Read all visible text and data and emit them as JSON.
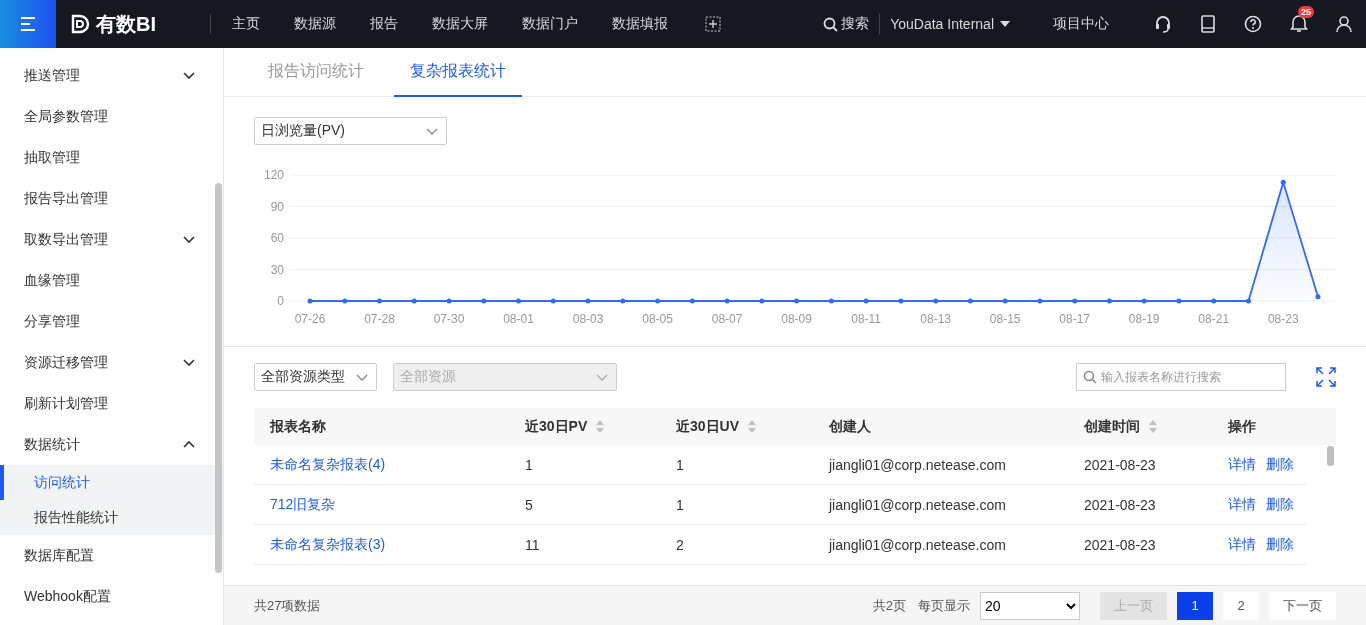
{
  "header": {
    "logo_text": "有数BI",
    "nav": [
      "主页",
      "数据源",
      "报告",
      "数据大屏",
      "数据门户",
      "数据填报"
    ],
    "search": "搜索",
    "workspace": "YouData Internal",
    "project_center": "项目中心",
    "notification_count": "25"
  },
  "sidebar": {
    "items": [
      {
        "label": "推送管理",
        "expanded": false,
        "selected": false,
        "kind": "group"
      },
      {
        "label": "全局参数管理",
        "selected": false,
        "kind": "item"
      },
      {
        "label": "抽取管理",
        "selected": false,
        "kind": "item"
      },
      {
        "label": "报告导出管理",
        "selected": false,
        "kind": "item"
      },
      {
        "label": "取数导出管理",
        "expanded": false,
        "selected": false,
        "kind": "group"
      },
      {
        "label": "血缘管理",
        "selected": false,
        "kind": "item"
      },
      {
        "label": "分享管理",
        "selected": false,
        "kind": "item"
      },
      {
        "label": "资源迁移管理",
        "expanded": false,
        "selected": false,
        "kind": "group"
      },
      {
        "label": "刷新计划管理",
        "selected": false,
        "kind": "item"
      },
      {
        "label": "数据统计",
        "expanded": true,
        "selected": false,
        "kind": "group",
        "children": [
          {
            "label": "访问统计",
            "selected": true
          },
          {
            "label": "报告性能统计",
            "selected": false
          }
        ]
      },
      {
        "label": "数据库配置",
        "selected": false,
        "kind": "item"
      },
      {
        "label": "Webhook配置",
        "selected": false,
        "kind": "item"
      }
    ]
  },
  "tabs": [
    {
      "label": "报告访问统计",
      "selected": false
    },
    {
      "label": "复杂报表统计",
      "selected": true
    }
  ],
  "metric_select": "日浏览量(PV)",
  "chart_data": {
    "type": "area",
    "grid": true,
    "categories": [
      "07-26",
      null,
      "07-28",
      null,
      "07-30",
      null,
      "08-01",
      null,
      "08-03",
      null,
      "08-05",
      null,
      "08-07",
      null,
      "08-09",
      null,
      "08-11",
      null,
      "08-13",
      null,
      "08-15",
      null,
      "08-17",
      null,
      "08-19",
      null,
      "08-21",
      null,
      "08-23",
      null
    ],
    "series": [
      {
        "color": "#2f6bf5",
        "values": [
          0,
          0,
          0,
          0,
          0,
          0,
          0,
          0,
          0,
          0,
          0,
          0,
          0,
          0,
          0,
          0,
          0,
          0,
          0,
          0,
          0,
          0,
          0,
          0,
          0,
          0,
          0,
          0,
          113,
          4
        ]
      }
    ],
    "ylim": [
      0,
      120
    ],
    "yticks": [
      0,
      30,
      60,
      90,
      120
    ]
  },
  "filters": {
    "type_select": {
      "value": "全部资源类型",
      "disabled": false
    },
    "resource_select": {
      "value": "全部资源",
      "disabled": true
    },
    "search": {
      "placeholder": "输入报表名称进行搜索"
    }
  },
  "table": {
    "columns": [
      {
        "label": "报表名称",
        "sortable": false
      },
      {
        "label": "近30日PV",
        "sortable": true
      },
      {
        "label": "近30日UV",
        "sortable": true
      },
      {
        "label": "创建人",
        "sortable": false
      },
      {
        "label": "创建时间",
        "sortable": true
      },
      {
        "label": "操作",
        "sortable": false
      }
    ],
    "rows": [
      {
        "name": "未命名复杂报表(4)",
        "pv": "1",
        "uv": "1",
        "creator": "jiangli01@corp.netease.com",
        "created": "2021-08-23",
        "actions": [
          "详情",
          "删除"
        ]
      },
      {
        "name": "712旧复杂",
        "pv": "5",
        "uv": "1",
        "creator": "jiangli01@corp.netease.com",
        "created": "2021-08-23",
        "actions": [
          "详情",
          "删除"
        ]
      },
      {
        "name": "未命名复杂报表(3)",
        "pv": "11",
        "uv": "2",
        "creator": "jiangli01@corp.netease.com",
        "created": "2021-08-23",
        "actions": [
          "详情",
          "删除"
        ]
      }
    ]
  },
  "pagination": {
    "total": "共27项数据",
    "page_count": "共2页",
    "per_page_label": "每页显示",
    "per_page": "20",
    "prev": {
      "label": "上一页",
      "disabled": true
    },
    "pages": [
      {
        "label": "1",
        "selected": true
      },
      {
        "label": "2",
        "selected": false
      }
    ],
    "next": {
      "label": "下一页",
      "disabled": false
    }
  }
}
